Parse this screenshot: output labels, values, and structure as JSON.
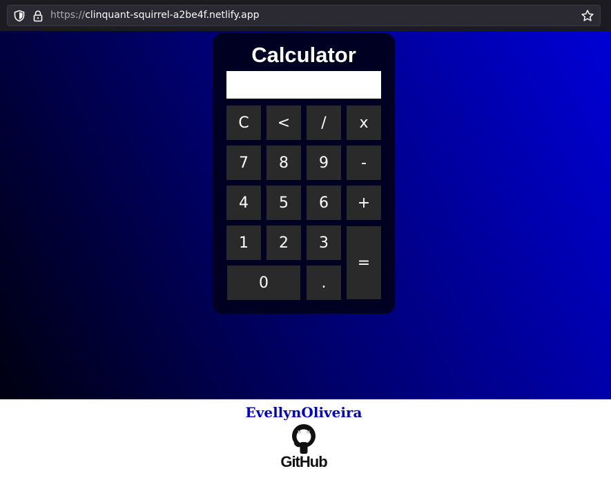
{
  "browser": {
    "url_protocol": "https://",
    "url_host": "clinquant-squirrel-a2be4f.netlify.app",
    "icons": [
      "shield-icon",
      "lock-icon",
      "star-icon"
    ]
  },
  "calculator": {
    "title": "Calculator",
    "display_value": "",
    "keys": {
      "clear": "C",
      "backspace": "<",
      "divide": "/",
      "multiply": "x",
      "seven": "7",
      "eight": "8",
      "nine": "9",
      "minus": "-",
      "four": "4",
      "five": "5",
      "six": "6",
      "plus": "+",
      "one": "1",
      "two": "2",
      "three": "3",
      "equals": "=",
      "zero": "0",
      "decimal": "."
    }
  },
  "footer": {
    "author": "EvellynOliveira",
    "github_label": "GitHub"
  },
  "colors": {
    "gradient_dark": "#000010",
    "gradient_light": "#0000d6",
    "calc_body": "#000022",
    "key_bg": "#2a2a2a",
    "author_link": "#0000cc"
  }
}
